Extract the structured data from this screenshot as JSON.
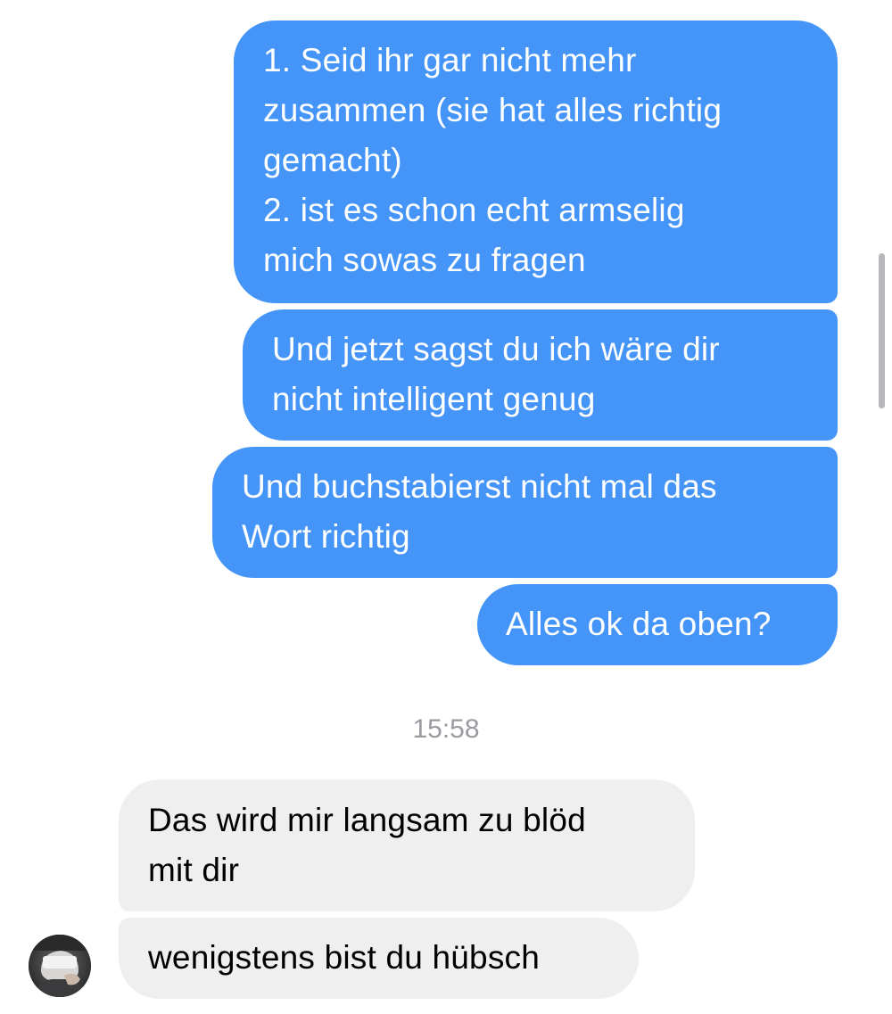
{
  "messages": [
    {
      "direction": "outgoing",
      "text": "1. Seid ihr gar nicht mehr\nzusammen (sie hat alles richtig\ngemacht)\n2. ist es schon echt armselig\nmich sowas zu fragen"
    },
    {
      "direction": "outgoing",
      "text": "Und jetzt sagst du ich wäre dir\nnicht intelligent genug"
    },
    {
      "direction": "outgoing",
      "text": "Und buchstabierst nicht mal das\nWort richtig"
    },
    {
      "direction": "outgoing",
      "text": "Alles ok da oben?"
    },
    {
      "direction": "incoming",
      "text": "Das wird mir langsam zu blöd\nmit dir"
    },
    {
      "direction": "incoming",
      "text": "wenigstens bist du hübsch"
    }
  ],
  "timestamp": "15:58",
  "colors": {
    "outgoing_bubble": "#4595f9",
    "incoming_bubble": "#efeff0",
    "timestamp_text": "#9a9aa0"
  },
  "icons": {
    "contact_avatar": "contact-avatar-photo"
  }
}
